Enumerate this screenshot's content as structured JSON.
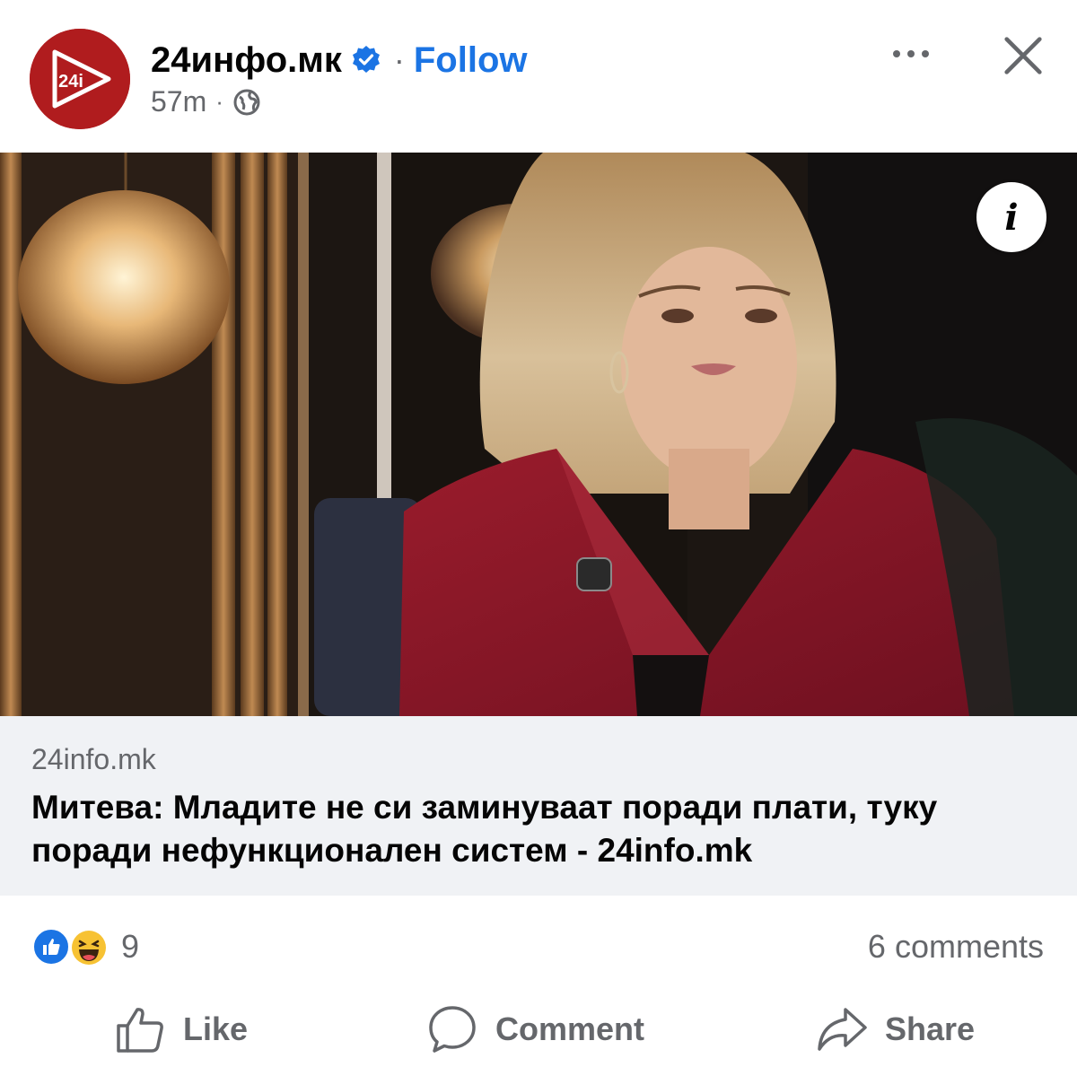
{
  "post": {
    "page_name": "24инфо.мк",
    "follow_label": "Follow",
    "time": "57m",
    "avatar_text": "24i"
  },
  "media": {
    "info_label": "i"
  },
  "link": {
    "domain": "24info.mk",
    "headline": "Митева: Младите не си заминуваат поради плати, туку поради нефункционален систем - 24info.mk"
  },
  "stats": {
    "reaction_count": "9",
    "comments": "6 comments"
  },
  "actions": {
    "like": "Like",
    "comment": "Comment",
    "share": "Share"
  },
  "colors": {
    "accent": "#1b74e4",
    "brand": "#b01c1e",
    "muted": "#65676b",
    "link_bg": "#f0f2f5"
  }
}
